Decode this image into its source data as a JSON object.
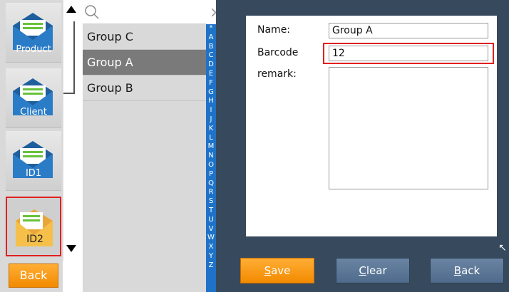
{
  "nav": {
    "items": [
      {
        "label": "Product",
        "icon": "envelope-icon",
        "selected": false
      },
      {
        "label": "Client",
        "icon": "envelope-icon",
        "selected": false
      },
      {
        "label": "ID1",
        "icon": "envelope-icon",
        "selected": false
      },
      {
        "label": "ID2",
        "icon": "envelope-open-icon",
        "selected": true
      }
    ],
    "back_label": "Back"
  },
  "search": {
    "value": "",
    "clear_glyph": "×"
  },
  "groups": {
    "items": [
      {
        "label": "Group C",
        "selected": false
      },
      {
        "label": "Group A",
        "selected": true
      },
      {
        "label": "Group B",
        "selected": false
      }
    ]
  },
  "alpha_index": [
    "*",
    "A",
    "B",
    "C",
    "D",
    "E",
    "F",
    "G",
    "H",
    "I",
    "J",
    "K",
    "L",
    "M",
    "N",
    "O",
    "P",
    "Q",
    "R",
    "S",
    "T",
    "U",
    "V",
    "W",
    "X",
    "Y",
    "Z"
  ],
  "form": {
    "name_label": "Name:",
    "name_value": "Group A",
    "barcode_label": "Barcode",
    "barcode_value": "12",
    "remark_label": "remark:",
    "remark_value": ""
  },
  "actions": {
    "save_first": "S",
    "save_rest": "ave",
    "clear_first": "C",
    "clear_rest": "lear",
    "back_first": "B",
    "back_rest": "ack"
  },
  "colors": {
    "panel_bg": "#37495c",
    "accent_orange": "#f28a00",
    "index_blue": "#1e73c8",
    "selection_red": "#e02020"
  }
}
